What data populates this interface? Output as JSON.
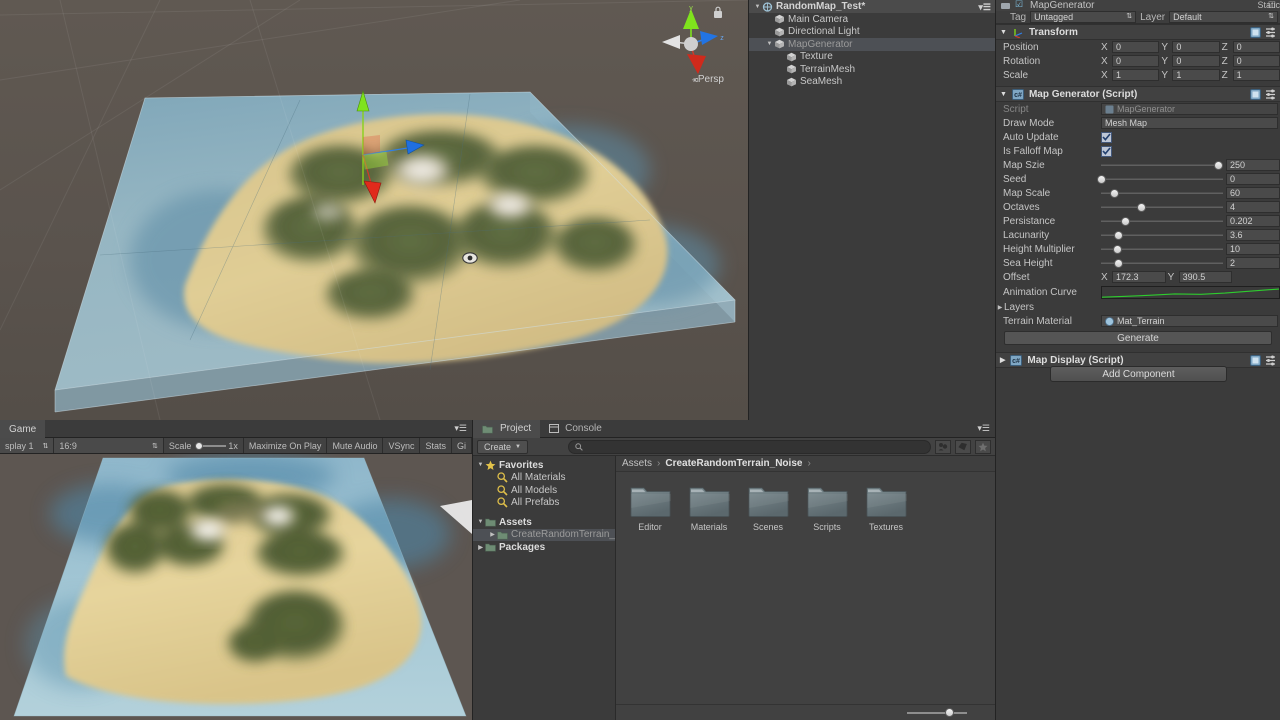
{
  "scene": {
    "gizmo": {
      "y_label": "y",
      "z_label": "z",
      "x_label": "x",
      "mode": "Persp"
    },
    "eye_icon": "eye-icon",
    "lock_icon": "lock-icon"
  },
  "game": {
    "tab_label": "Game",
    "toolbar": {
      "display": "splay 1",
      "aspect": "16:9",
      "scale_label": "Scale",
      "scale_value": "1x",
      "maximize": "Maximize On Play",
      "mute": "Mute Audio",
      "vsync": "VSync",
      "stats": "Stats",
      "gizmos": "Gi"
    }
  },
  "hierarchy": {
    "scene_name": "RandomMap_Test*",
    "items": [
      {
        "label": "Main Camera",
        "indent": 1,
        "selected": false,
        "expandable": false
      },
      {
        "label": "Directional Light",
        "indent": 1,
        "selected": false,
        "expandable": false
      },
      {
        "label": "MapGenerator",
        "indent": 1,
        "selected": true,
        "expandable": true
      },
      {
        "label": "Texture",
        "indent": 2,
        "selected": false,
        "expandable": false
      },
      {
        "label": "TerrainMesh",
        "indent": 2,
        "selected": false,
        "expandable": false
      },
      {
        "label": "SeaMesh",
        "indent": 2,
        "selected": false,
        "expandable": false
      }
    ]
  },
  "project": {
    "tabs": [
      {
        "label": "Project",
        "active": true,
        "icon": "folder-icon"
      },
      {
        "label": "Console",
        "active": false,
        "icon": "console-icon"
      }
    ],
    "create_label": "Create",
    "search_placeholder": "",
    "filter_icons": [
      "type-filter-icon",
      "label-filter-icon",
      "favorite-filter-icon"
    ],
    "tree": [
      {
        "label": "Favorites",
        "indent": 0,
        "bold": true,
        "tri": "down",
        "icon": "star-icon"
      },
      {
        "label": "All Materials",
        "indent": 1,
        "bold": false,
        "tri": "",
        "icon": "search-icon"
      },
      {
        "label": "All Models",
        "indent": 1,
        "bold": false,
        "tri": "",
        "icon": "search-icon"
      },
      {
        "label": "All Prefabs",
        "indent": 1,
        "bold": false,
        "tri": "",
        "icon": "search-icon"
      },
      {
        "label": "",
        "indent": 0,
        "bold": false,
        "tri": "",
        "icon": ""
      },
      {
        "label": "Assets",
        "indent": 0,
        "bold": true,
        "tri": "down",
        "icon": "folder-icon"
      },
      {
        "label": "CreateRandomTerrain_",
        "indent": 1,
        "bold": false,
        "tri": "right",
        "icon": "folder-icon",
        "selected": true
      },
      {
        "label": "Packages",
        "indent": 0,
        "bold": true,
        "tri": "right",
        "icon": "folder-icon"
      }
    ],
    "breadcrumb": [
      "Assets",
      "CreateRandomTerrain_Noise",
      ""
    ],
    "folders": [
      "Editor",
      "Materials",
      "Scenes",
      "Scripts",
      "Textures"
    ]
  },
  "inspector": {
    "object_name": "MapGenerator",
    "static_label": "Static",
    "tag_label": "Tag",
    "tag_value": "Untagged",
    "layer_label": "Layer",
    "layer_value": "Default",
    "transform": {
      "title": "Transform",
      "rows": [
        {
          "label": "Position",
          "x": "0",
          "y": "0",
          "z": "0"
        },
        {
          "label": "Rotation",
          "x": "0",
          "y": "0",
          "z": "0"
        },
        {
          "label": "Scale",
          "x": "1",
          "y": "1",
          "z": "1"
        }
      ]
    },
    "map_generator": {
      "title": "Map Generator (Script)",
      "script_label": "Script",
      "script_value": "MapGenerator",
      "draw_mode_label": "Draw Mode",
      "draw_mode_value": "Mesh Map",
      "auto_update_label": "Auto Update",
      "auto_update_checked": true,
      "is_falloff_label": "Is Falloff Map",
      "is_falloff_checked": true,
      "sliders": [
        {
          "label": "Map Szie",
          "value": "250",
          "pos": 96
        },
        {
          "label": "Seed",
          "value": "0",
          "pos": 0
        },
        {
          "label": "Map Scale",
          "value": "60",
          "pos": 11
        },
        {
          "label": "Octaves",
          "value": "4",
          "pos": 33
        },
        {
          "label": "Persistance",
          "value": "0.202",
          "pos": 20
        },
        {
          "label": "Lacunarity",
          "value": "3.6",
          "pos": 14
        },
        {
          "label": "Height Multiplier",
          "value": "10",
          "pos": 13
        },
        {
          "label": "Sea Height",
          "value": "2",
          "pos": 14
        }
      ],
      "offset_label": "Offset",
      "offset_x": "172.3",
      "offset_y": "390.5",
      "animation_curve_label": "Animation Curve",
      "layers_label": "Layers",
      "terrain_material_label": "Terrain Material",
      "terrain_material_value": "Mat_Terrain",
      "generate_label": "Generate"
    },
    "map_display": {
      "title": "Map Display (Script)"
    },
    "add_component_label": "Add Component"
  },
  "colors": {
    "panel_bg": "#3b3b3b",
    "selection": "#4d5055",
    "checkbox": "#bdc6d6",
    "curve_green": "#2ecc2e",
    "axis_x": "#d43a2a",
    "axis_y": "#7fe31d",
    "axis_z": "#2f7fe8"
  }
}
